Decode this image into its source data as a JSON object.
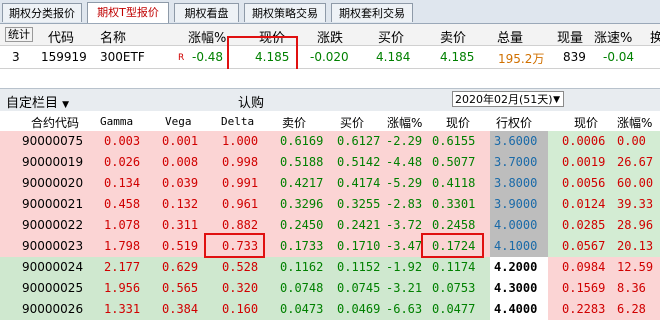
{
  "tabs": [
    "期权分类报价",
    "期权T型报价",
    "期权看盘",
    "期权策略交易",
    "期权套利交易"
  ],
  "quote": {
    "headers": [
      "统计",
      "代码",
      "名称",
      "涨幅%",
      "现价",
      "涨跌",
      "买价",
      "卖价",
      "总量",
      "现量",
      "涨速%",
      "换"
    ],
    "row": {
      "seq": "3",
      "code": "159919",
      "name": "300ETF",
      "flag": "R",
      "change_pct": "-0.48",
      "price": "4.185",
      "change": "-0.020",
      "bid": "4.184",
      "ask": "4.185",
      "volume": "195.2万",
      "last_vol": "839",
      "speed": "-0.04"
    }
  },
  "toolbar": {
    "custom_column": "自定栏目",
    "dropdown_arrow": "▼",
    "call_label": "认购",
    "expiry_select": "2020年02月(51天)"
  },
  "columns": [
    "合约代码",
    "Gamma",
    "Vega",
    "Delta",
    "卖价",
    "买价",
    "涨幅%",
    "现价",
    "行权价",
    "现价",
    "涨幅%"
  ],
  "rows": [
    {
      "code": "90000075",
      "gamma": "0.003",
      "vega": "0.001",
      "delta": "1.000",
      "ask": "0.6169",
      "bid": "0.6127",
      "chg": "-2.29",
      "price": "0.6155",
      "strike": "3.6000",
      "put_price": "0.0006",
      "put_chg": "0.00",
      "style": "pink"
    },
    {
      "code": "90000019",
      "gamma": "0.026",
      "vega": "0.008",
      "delta": "0.998",
      "ask": "0.5188",
      "bid": "0.5142",
      "chg": "-4.48",
      "price": "0.5077",
      "strike": "3.7000",
      "put_price": "0.0019",
      "put_chg": "26.67",
      "style": "pink"
    },
    {
      "code": "90000020",
      "gamma": "0.134",
      "vega": "0.039",
      "delta": "0.991",
      "ask": "0.4217",
      "bid": "0.4174",
      "chg": "-5.29",
      "price": "0.4118",
      "strike": "3.8000",
      "put_price": "0.0056",
      "put_chg": "60.00",
      "style": "pink"
    },
    {
      "code": "90000021",
      "gamma": "0.458",
      "vega": "0.132",
      "delta": "0.961",
      "ask": "0.3296",
      "bid": "0.3255",
      "chg": "-2.83",
      "price": "0.3301",
      "strike": "3.9000",
      "put_price": "0.0124",
      "put_chg": "39.33",
      "style": "pink"
    },
    {
      "code": "90000022",
      "gamma": "1.078",
      "vega": "0.311",
      "delta": "0.882",
      "ask": "0.2450",
      "bid": "0.2421",
      "chg": "-3.72",
      "price": "0.2458",
      "strike": "4.0000",
      "put_price": "0.0285",
      "put_chg": "28.96",
      "style": "pink"
    },
    {
      "code": "90000023",
      "gamma": "1.798",
      "vega": "0.519",
      "delta": "0.733",
      "ask": "0.1733",
      "bid": "0.1710",
      "chg": "-3.47",
      "price": "0.1724",
      "strike": "4.1000",
      "put_price": "0.0567",
      "put_chg": "20.13",
      "style": "pink"
    },
    {
      "code": "90000024",
      "gamma": "2.177",
      "vega": "0.629",
      "delta": "0.528",
      "ask": "0.1162",
      "bid": "0.1152",
      "chg": "-1.92",
      "price": "0.1174",
      "strike": "4.2000",
      "put_price": "0.0984",
      "put_chg": "12.59",
      "style": "green"
    },
    {
      "code": "90000025",
      "gamma": "1.956",
      "vega": "0.565",
      "delta": "0.320",
      "ask": "0.0748",
      "bid": "0.0745",
      "chg": "-3.21",
      "price": "0.0753",
      "strike": "4.3000",
      "put_price": "0.1569",
      "put_chg": "8.36",
      "style": "green"
    },
    {
      "code": "90000026",
      "gamma": "1.331",
      "vega": "0.384",
      "delta": "0.160",
      "ask": "0.0473",
      "bid": "0.0469",
      "chg": "-6.63",
      "price": "0.0477",
      "strike": "4.4000",
      "put_price": "0.2283",
      "put_chg": "6.28",
      "style": "green"
    }
  ],
  "colors": {
    "red": "#d00000",
    "green": "#008000",
    "highlight": "#e01010",
    "strike_blue": "#1a6aa8"
  }
}
